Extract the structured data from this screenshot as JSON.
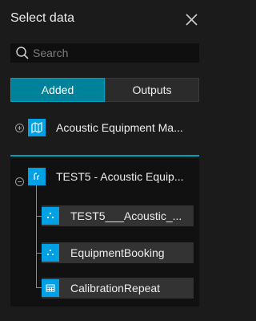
{
  "header": {
    "title": "Select data"
  },
  "search": {
    "placeholder": "Search"
  },
  "tabs": [
    {
      "label": "Added",
      "active": true
    },
    {
      "label": "Outputs",
      "active": false
    }
  ],
  "items": [
    {
      "label": "Acoustic Equipment Ma...",
      "icon": "map-icon",
      "expanded": false
    }
  ],
  "group": {
    "label": "TEST5 - Acoustic Equip...",
    "icon": "feature-service-icon",
    "expanded": true,
    "children": [
      {
        "label": "TEST5___Acoustic_...",
        "icon": "point-layer-icon"
      },
      {
        "label": "EquipmentBooking",
        "icon": "point-layer-icon"
      },
      {
        "label": "CalibrationRepeat",
        "icon": "table-icon"
      }
    ]
  },
  "colors": {
    "accent": "#00829b",
    "icon_bg": "#00a0e4",
    "background": "#1b1b1b"
  }
}
